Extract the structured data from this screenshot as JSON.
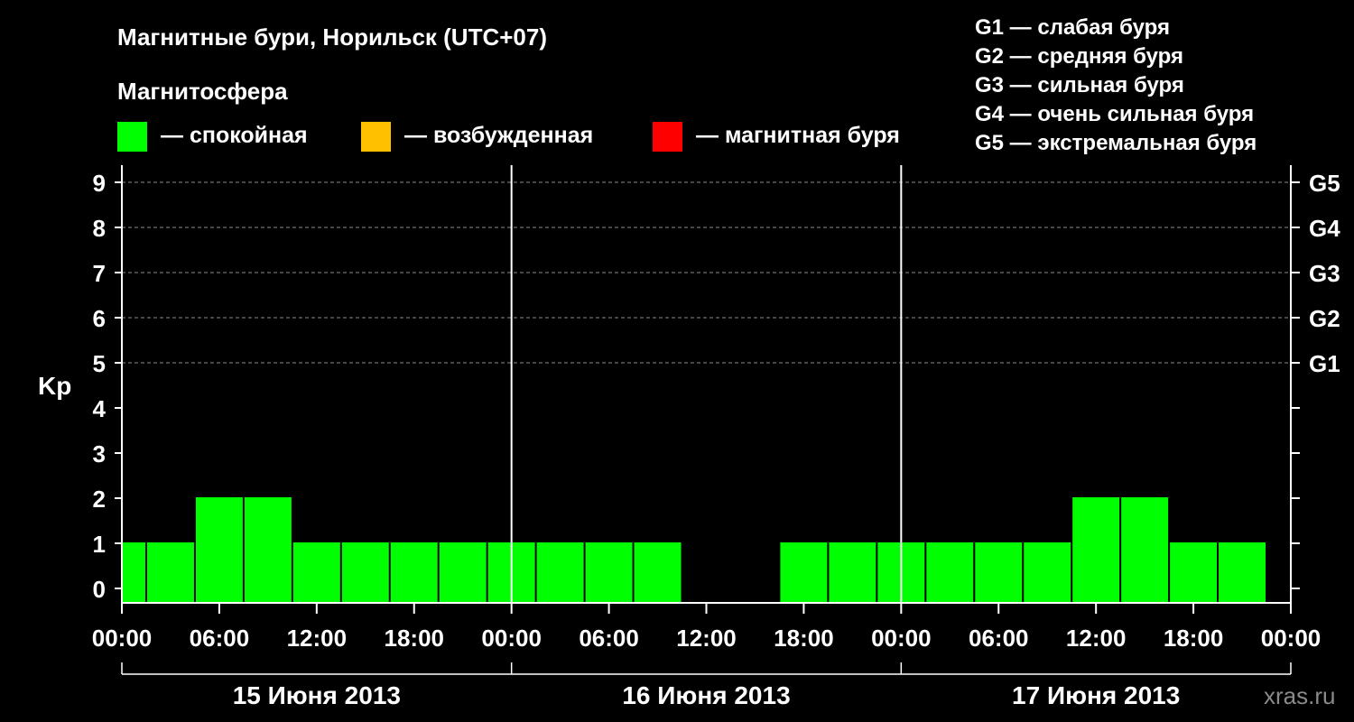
{
  "chart_data": {
    "type": "bar",
    "title": "Магнитные бури, Норильск (UTC+07)",
    "legend_title": "Магнитосфера",
    "legend": [
      {
        "label": "— спокойная",
        "color": "#00ff00"
      },
      {
        "label": "— возбужденная",
        "color": "#ffc000"
      },
      {
        "label": "— магнитная буря",
        "color": "#ff0000"
      }
    ],
    "storm_scale": [
      "G1 — слабая буря",
      "G2 — средняя буря",
      "G3 — сильная буря",
      "G4 — очень сильная буря",
      "G5 — экстремальная буря"
    ],
    "ylabel": "Kp",
    "ylim": [
      0,
      9
    ],
    "y_ticks": [
      "0",
      "1",
      "2",
      "3",
      "4",
      "5",
      "6",
      "7",
      "8",
      "9"
    ],
    "right_ticks": [
      {
        "value": 5,
        "label": "G1"
      },
      {
        "value": 6,
        "label": "G2"
      },
      {
        "value": 7,
        "label": "G3"
      },
      {
        "value": 8,
        "label": "G4"
      },
      {
        "value": 9,
        "label": "G5"
      }
    ],
    "x_tick_labels": [
      "00:00",
      "06:00",
      "12:00",
      "18:00",
      "00:00",
      "06:00",
      "12:00",
      "18:00",
      "00:00",
      "06:00",
      "12:00",
      "18:00",
      "00:00"
    ],
    "days": [
      "15 Июня 2013",
      "16 Июня 2013",
      "17 Июня 2013"
    ],
    "interval_hours": 3,
    "values": [
      1,
      1,
      2,
      2,
      1,
      1,
      1,
      1,
      1,
      1,
      1,
      1,
      0,
      0,
      1,
      1,
      1,
      1,
      1,
      1,
      2,
      2,
      1,
      1
    ],
    "grid": "dashed horizontal"
  },
  "watermark": "xras.ru"
}
